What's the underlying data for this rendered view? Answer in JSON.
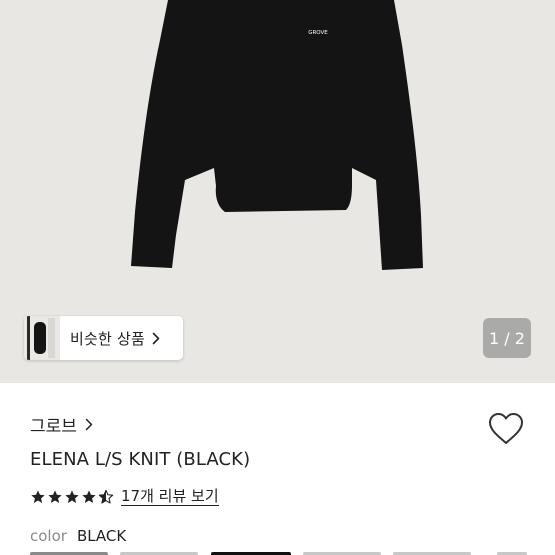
{
  "gallery": {
    "image_text": "GROVE",
    "similar_products_label": "비슷한 상품",
    "page_indicator": "1 / 2"
  },
  "product": {
    "brand": "그로브",
    "title": "ELENA L/S KNIT (BLACK)",
    "rating": 4.5,
    "review_link": "17개 리뷰 보기",
    "color_label": "color",
    "color_value": "BLACK"
  },
  "icons": {
    "similar_chevron": "chevron-right-icon",
    "brand_chevron": "chevron-right-icon",
    "wishlist": "heart-icon",
    "star": "star-icon"
  },
  "colors": {
    "gallery_bg": "#e8e7e3",
    "text": "#222222",
    "muted": "#8a8a8a",
    "indicator_bg": "#969696"
  }
}
